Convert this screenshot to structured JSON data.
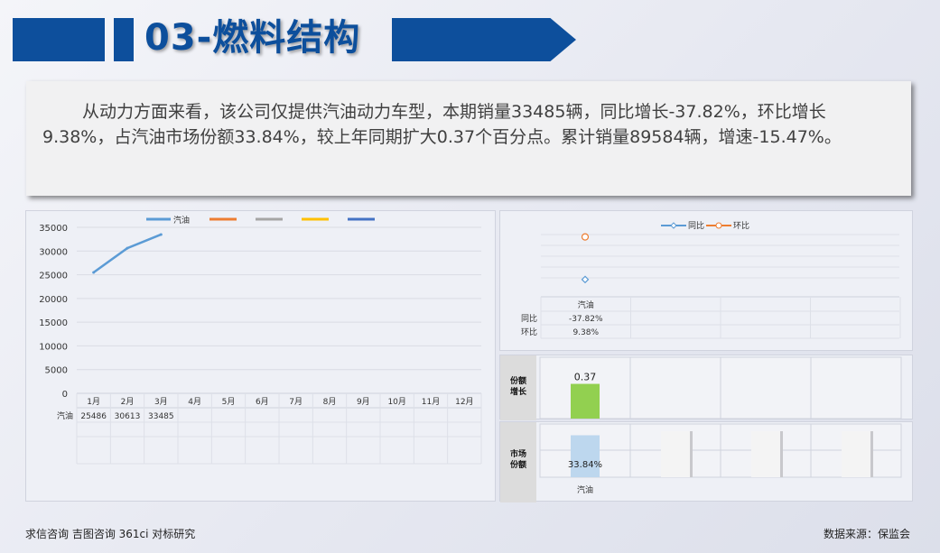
{
  "header": {
    "title": "03-燃料结构"
  },
  "summary": {
    "text": "从动力方面来看，该公司仅提供汽油动力车型，本期销量33485辆，同比增长-37.82%，环比增长9.38%，占汽油市场份额33.84%，较上年同期扩大0.37个百分点。累计销量89584辆，增速-15.47%。"
  },
  "colors": {
    "brand": "#0d4f9c",
    "series_gasoline": "#5b9bd5",
    "orange": "#ed7d31",
    "gray": "#a5a5a5",
    "yellow": "#ffc000",
    "blue2": "#4472c4",
    "share_bar": "#92d050",
    "market_bar": "#bdd7ee"
  },
  "chart_data": [
    {
      "type": "line",
      "categories": [
        "1月",
        "2月",
        "3月",
        "4月",
        "5月",
        "6月",
        "7月",
        "8月",
        "9月",
        "10月",
        "11月",
        "12月"
      ],
      "series": [
        {
          "name": "汽油",
          "values": [
            25486,
            30613,
            33485,
            null,
            null,
            null,
            null,
            null,
            null,
            null,
            null,
            null
          ]
        }
      ],
      "legend_extra_count": 4,
      "y_ticks": [
        0,
        5000,
        10000,
        15000,
        20000,
        25000,
        30000,
        35000
      ],
      "ylim": [
        0,
        35000
      ],
      "grid": true,
      "legend": "top",
      "table": {
        "row_label": "汽油",
        "values": [
          "25486",
          "30613",
          "33485",
          "",
          "",
          "",
          "",
          "",
          "",
          "",
          "",
          ""
        ]
      }
    },
    {
      "type": "scatter",
      "legend": "top",
      "legend_labels": [
        "同比",
        "环比"
      ],
      "categories": [
        "汽油"
      ],
      "series": [
        {
          "name": "同比",
          "values": [
            -37.82
          ],
          "label": "-37.82%"
        },
        {
          "name": "环比",
          "values": [
            9.38
          ],
          "label": "9.38%"
        }
      ],
      "table": {
        "col_label": "汽油",
        "rows": [
          {
            "label": "同比",
            "value": "-37.82%"
          },
          {
            "label": "环比",
            "value": "9.38%"
          }
        ]
      }
    },
    {
      "type": "bar",
      "row_label_line1": "份额",
      "row_label_line2": "增长",
      "categories": [
        ""
      ],
      "values": [
        0.37
      ],
      "data_label": "0.37"
    },
    {
      "type": "bar",
      "row_label_line1": "市场",
      "row_label_line2": "份额",
      "categories": [
        "汽油"
      ],
      "values": [
        33.84
      ],
      "data_label": "33.84%",
      "x_label": "汽油"
    }
  ],
  "footer": {
    "left": "求信咨询 吉图咨询 361ci 对标研究",
    "right": "数据来源：保监会"
  }
}
